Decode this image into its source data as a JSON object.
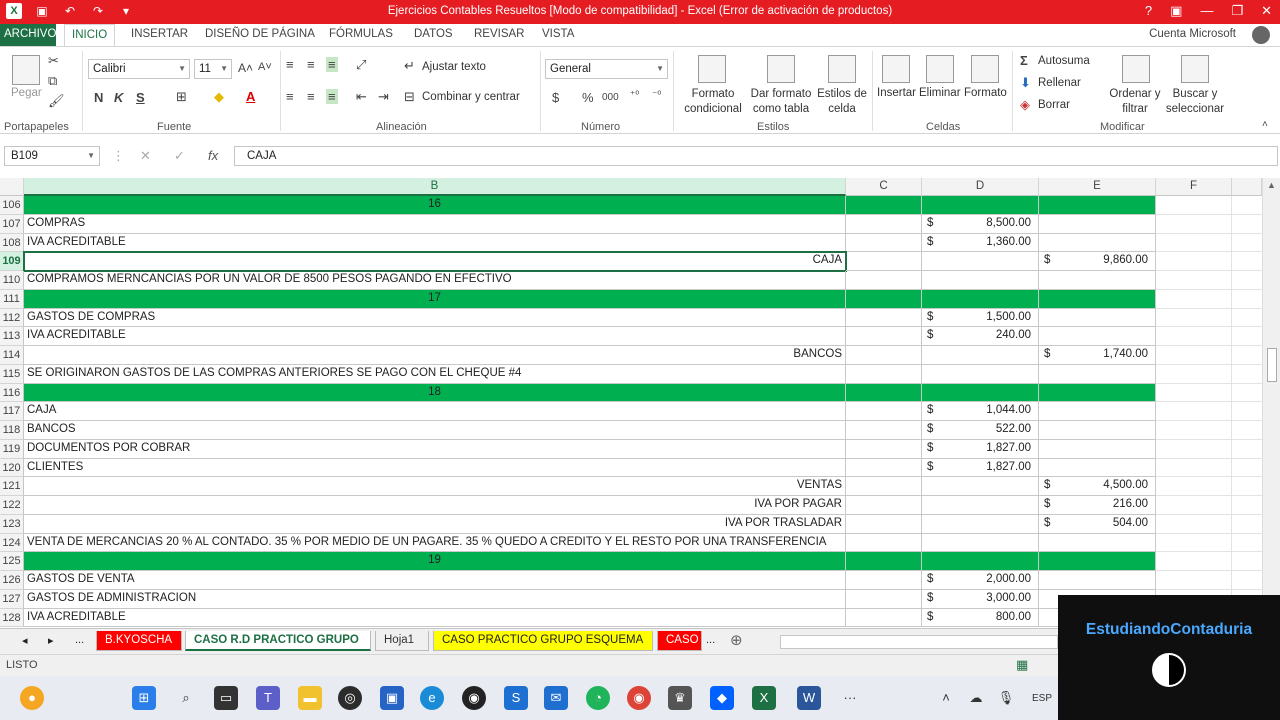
{
  "window": {
    "title": "Ejercicios Contables Resueltos  [Modo de compatibilidad] -  Excel (Error de activación de productos)",
    "controls": [
      "?",
      "▣",
      "—",
      "❐",
      "✕"
    ]
  },
  "ribbon_tabs": [
    "ARCHIVO",
    "INICIO",
    "INSERTAR",
    "DISEÑO DE PÁGINA",
    "FÓRMULAS",
    "DATOS",
    "REVISAR",
    "VISTA"
  ],
  "account": "Cuenta Microsoft",
  "ribbon": {
    "portapapeles": {
      "paste": "Pegar",
      "label": "Portapapeles"
    },
    "fuente": {
      "font": "Calibri",
      "size": "11",
      "bold": "N",
      "italic": "K",
      "underline": "S",
      "label": "Fuente"
    },
    "alineacion": {
      "wrap": "Ajustar texto",
      "merge": "Combinar y centrar",
      "label": "Alineación"
    },
    "numero": {
      "format": "General",
      "currency": "$",
      "percent": "%",
      "thousands": "000",
      "label": "Número"
    },
    "estilos": {
      "cond": "Formato condicional",
      "table": "Dar formato como tabla",
      "cellstyles": "Estilos de celda",
      "label": "Estilos"
    },
    "celdas": {
      "insert": "Insertar",
      "delete": "Eliminar",
      "format": "Formato",
      "label": "Celdas"
    },
    "modificar": {
      "autosum": "Autosuma",
      "fill": "Rellenar",
      "clear": "Borrar",
      "sort": "Ordenar y filtrar",
      "find": "Buscar y seleccionar",
      "label": "Modificar"
    }
  },
  "formula_bar": {
    "name_box": "B109",
    "fx": "fx",
    "value": "CAJA"
  },
  "columns": [
    "B",
    "C",
    "D",
    "E",
    "F"
  ],
  "rows": [
    {
      "num": "106",
      "type": "header",
      "b": "16"
    },
    {
      "num": "107",
      "b": "COMPRAS",
      "d_cur": "$",
      "d": "8,500.00"
    },
    {
      "num": "108",
      "b": "IVA ACREDITABLE",
      "d_cur": "$",
      "d": "1,360.00"
    },
    {
      "num": "109",
      "b": "CAJA",
      "align": "right",
      "e_cur": "$",
      "e": "9,860.00",
      "selected": true
    },
    {
      "num": "110",
      "b": "COMPRAMOS MERNCANCIAS POR UN VALOR DE 8500 PESOS PAGANDO EN EFECTIVO"
    },
    {
      "num": "111",
      "type": "header",
      "b": "17"
    },
    {
      "num": "112",
      "b": "GASTOS DE COMPRAS",
      "d_cur": "$",
      "d": "1,500.00"
    },
    {
      "num": "113",
      "b": "IVA ACREDITABLE",
      "d_cur": "$",
      "d": "240.00"
    },
    {
      "num": "114",
      "b": "BANCOS",
      "align": "right",
      "e_cur": "$",
      "e": "1,740.00"
    },
    {
      "num": "115",
      "b": "SE ORIGINARON GASTOS DE LAS COMPRAS ANTERIORES SE PAGO CON EL CHEQUE #4"
    },
    {
      "num": "116",
      "type": "header",
      "b": "18"
    },
    {
      "num": "117",
      "b": "CAJA",
      "d_cur": "$",
      "d": "1,044.00"
    },
    {
      "num": "118",
      "b": "BANCOS",
      "d_cur": "$",
      "d": "522.00"
    },
    {
      "num": "119",
      "b": "DOCUMENTOS POR COBRAR",
      "d_cur": "$",
      "d": "1,827.00"
    },
    {
      "num": "120",
      "b": "CLIENTES",
      "d_cur": "$",
      "d": "1,827.00"
    },
    {
      "num": "121",
      "b": "VENTAS",
      "align": "right",
      "e_cur": "$",
      "e": "4,500.00"
    },
    {
      "num": "122",
      "b": "IVA POR PAGAR",
      "align": "right",
      "e_cur": "$",
      "e": "216.00"
    },
    {
      "num": "123",
      "b": "IVA POR TRASLADAR",
      "align": "right",
      "e_cur": "$",
      "e": "504.00"
    },
    {
      "num": "124",
      "b": "VENTA DE MERCANCIAS 20 % AL CONTADO. 35 % POR MEDIO DE UN PAGARE. 35 % QUEDO A CREDITO Y EL RESTO POR UNA TRANSFERENCIA"
    },
    {
      "num": "125",
      "type": "header",
      "b": "19"
    },
    {
      "num": "126",
      "b": "GASTOS DE VENTA",
      "d_cur": "$",
      "d": "2,000.00"
    },
    {
      "num": "127",
      "b": "GASTOS DE ADMINISTRACION",
      "d_cur": "$",
      "d": "3,000.00"
    },
    {
      "num": "128",
      "b": "IVA ACREDITABLE",
      "d_cur": "$",
      "d": "800.00"
    }
  ],
  "sheet_tabs": [
    {
      "label": "B.KYOSCHA",
      "bg": "#ff0000",
      "fg": "#ffffff"
    },
    {
      "label": "CASO R.D PRACTICO GRUPO",
      "bg": "#ffffff",
      "fg": "#1d7044",
      "active": true
    },
    {
      "label": "Hoja1",
      "bg": "#f0f0f0",
      "fg": "#333333"
    },
    {
      "label": "CASO PRACTICO GRUPO ESQUEMA",
      "bg": "#ffff00",
      "fg": "#222222"
    },
    {
      "label": "CASO",
      "bg": "#ff0000",
      "fg": "#ffffff"
    }
  ],
  "sheet_nav": {
    "prev": "◂",
    "next": "▸",
    "more": "...",
    "add": "⊕"
  },
  "status": {
    "mode": "LISTO"
  },
  "taskbar": {
    "lang": "ESP"
  },
  "watermark": {
    "text": "EstudiandoContaduria"
  }
}
